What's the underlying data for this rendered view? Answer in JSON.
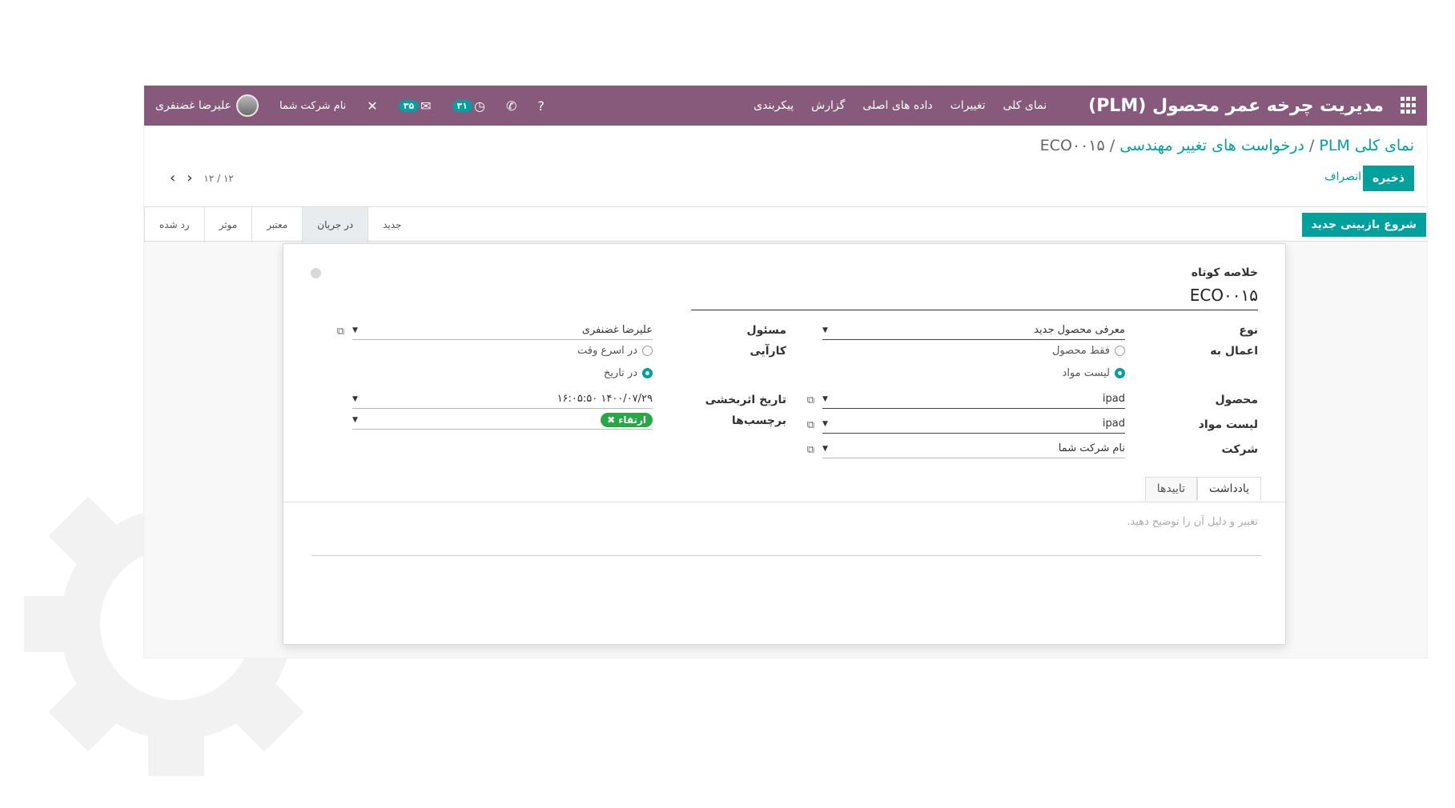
{
  "topbar": {
    "app_title": "مدیریت چرخه عمر محصول (PLM)",
    "menu": [
      "نمای کلی",
      "تغییرات",
      "داده های اصلی",
      "گزارش",
      "پیکربندی"
    ],
    "company": "نام شرکت شما",
    "user_name": "علیرضا غضنفری",
    "messages_count": "۳۵",
    "activities_count": "۳۱"
  },
  "breadcrumb": {
    "root": "نمای کلی PLM",
    "parent": "درخواست های تغییر مهندسی",
    "current": "ECO۰۰۱۵"
  },
  "actions": {
    "save": "ذخیره",
    "discard": "انصراف",
    "start_review": "شروع بازبینی جدید"
  },
  "pager": {
    "value": "۱۲ / ۱۲"
  },
  "stages": [
    "جدید",
    "در جریان",
    "معتبر",
    "موثر",
    "رد شده"
  ],
  "active_stage": "در جریان",
  "form": {
    "summary_label": "خلاصه کوتاه",
    "summary_value": "ECO۰۰۱۵",
    "type_label": "نوع",
    "type_value": "معرفی محصول جدید",
    "apply_label": "اعمال به",
    "apply_opt1": "فقط محصول",
    "apply_opt2": "لیست مواد",
    "product_label": "محصول",
    "product_value": "ipad",
    "bom_label": "لیست مواد",
    "bom_value": "ipad",
    "company_label": "شرکت",
    "company_value": "نام شرکت شما",
    "responsible_label": "مسئول",
    "responsible_value": "علیرضا غضنفری",
    "efficiency_label": "کارآیی",
    "eff_opt1": "در اسرع وقت",
    "eff_opt2": "در تاریخ",
    "effective_date_label": "تاریخ اثربخشی",
    "effective_date_value": "۱۴۰۰/۰۷/۲۹ ۱۶:۰۵:۵۰",
    "tags_label": "برچسب‌ها",
    "tag_value": "ارتقاء"
  },
  "tabs": [
    "یادداشت",
    "تاییدها"
  ],
  "notes_placeholder": "تغییر و دلیل آن را توضیح دهید."
}
